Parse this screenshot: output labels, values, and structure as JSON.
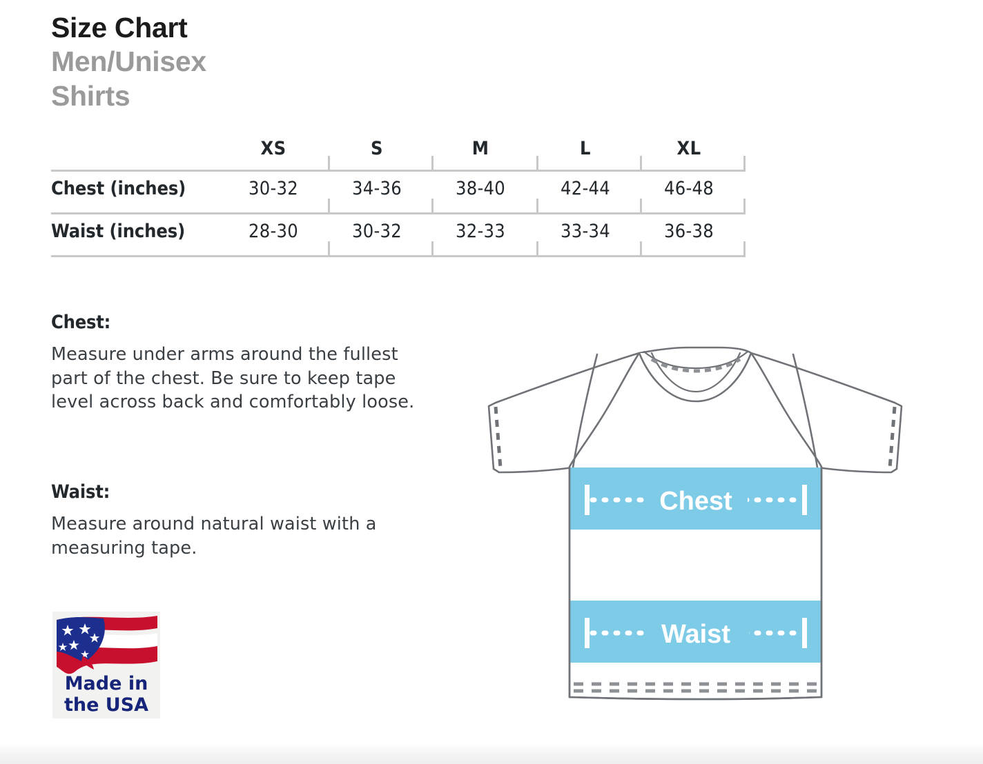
{
  "header": {
    "title": "Size Chart",
    "subtitle_line1": "Men/Unisex",
    "subtitle_line2": "Shirts"
  },
  "chart_data": {
    "type": "table",
    "title": "Size Chart Men/Unisex Shirts",
    "columns": [
      "",
      "XS",
      "S",
      "M",
      "L",
      "XL"
    ],
    "rows": [
      {
        "label": "Chest (inches)",
        "values": [
          "30-32",
          "34-36",
          "38-40",
          "42-44",
          "46-48"
        ]
      },
      {
        "label": "Waist (inches)",
        "values": [
          "28-30",
          "30-32",
          "32-33",
          "33-34",
          "36-38"
        ]
      }
    ],
    "units": "inches",
    "categories": [
      "XS",
      "S",
      "M",
      "L",
      "XL"
    ],
    "series": [
      {
        "name": "Chest (inches)",
        "values": [
          "30-32",
          "34-36",
          "38-40",
          "42-44",
          "46-48"
        ]
      },
      {
        "name": "Waist (inches)",
        "values": [
          "28-30",
          "30-32",
          "32-33",
          "33-34",
          "36-38"
        ]
      }
    ]
  },
  "table": {
    "headers": [
      "XS",
      "S",
      "M",
      "L",
      "XL"
    ],
    "row_chest": {
      "label": "Chest (inches)",
      "xs": "30-32",
      "s": "34-36",
      "m": "38-40",
      "l": "42-44",
      "xl": "46-48"
    },
    "row_waist": {
      "label": "Waist (inches)",
      "xs": "28-30",
      "s": "30-32",
      "m": "32-33",
      "l": "33-34",
      "xl": "36-38"
    }
  },
  "instructions": {
    "chest": {
      "heading": "Chest:",
      "body": "Measure under arms around the fullest part of the chest. Be sure to keep tape level across back and comfortably loose."
    },
    "waist": {
      "heading": "Waist:",
      "body": "Measure around natural waist with a measuring tape."
    }
  },
  "badge": {
    "line1": "Made in",
    "line2": "the USA",
    "flag_blue": "#1c2f8f",
    "flag_red": "#c8102e",
    "text_blue": "#16247a"
  },
  "illustration": {
    "chest_band_label": "Chest",
    "waist_band_label": "Waist",
    "band_color": "#7ecbe8",
    "outline_color": "#6f7276",
    "label_color": "#ffffff"
  }
}
